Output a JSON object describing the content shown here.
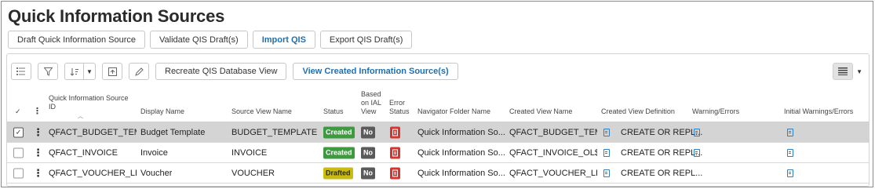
{
  "page": {
    "title": "Quick Information Sources"
  },
  "commands": [
    {
      "label": "Draft Quick Information Source"
    },
    {
      "label": "Validate QIS Draft(s)"
    },
    {
      "label": "Import QIS"
    },
    {
      "label": "Export QIS Draft(s)"
    }
  ],
  "toolbar": {
    "icons": [
      "list-icon",
      "filter-icon",
      "sort-icon",
      "export-icon",
      "edit-icon"
    ],
    "recreate_label": "Recreate QIS Database View",
    "view_created_label": "View Created Information Source(s)"
  },
  "table": {
    "headers": {
      "qis_id_line1": "Quick Information Source",
      "qis_id_line2": "ID",
      "display_name": "Display Name",
      "source_view": "Source View Name",
      "status": "Status",
      "based_l1": "Based",
      "based_l2": "on IAL",
      "based_l3": "View",
      "error_l1": "Error",
      "error_l2": "Status",
      "nav_folder": "Navigator Folder Name",
      "created_view": "Created View Name",
      "created_def": "Created View Definition",
      "warnings": "Warning/Errors",
      "initial_warnings": "Initial Warnings/Errors"
    },
    "rows": [
      {
        "id": "QFACT_BUDGET_TEM...",
        "display": "Budget Template",
        "source": "BUDGET_TEMPLATE",
        "status": "Created",
        "based": "No",
        "nav": "Quick Information So...",
        "created_view": "QFACT_BUDGET_TEM...",
        "created_def": "CREATE OR REPL...",
        "selected": true
      },
      {
        "id": "QFACT_INVOICE",
        "display": "Invoice",
        "source": "INVOICE",
        "status": "Created",
        "based": "No",
        "nav": "Quick Information So...",
        "created_view": "QFACT_INVOICE_OL$",
        "created_def": "CREATE OR REPL...",
        "selected": false
      },
      {
        "id": "QFACT_VOUCHER_LL",
        "display": "Voucher",
        "source": "VOUCHER",
        "status": "Drafted",
        "based": "No",
        "nav": "Quick Information So...",
        "created_view": "QFACT_VOUCHER_LL_...",
        "created_def": "CREATE OR REPL...",
        "selected": false
      }
    ]
  },
  "colors": {
    "created": "#3d9a3f",
    "drafted": "#c9bb12",
    "no": "#5a5a5a",
    "error": "#d8342f",
    "accent": "#1f6fb2"
  }
}
